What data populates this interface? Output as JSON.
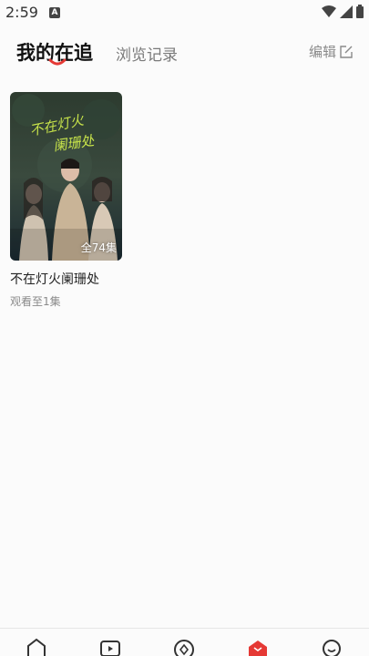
{
  "status_bar": {
    "time": "2:59",
    "notification_icon": "A"
  },
  "tabs": {
    "following_label": "我的在追",
    "history_label": "浏览记录",
    "edit_label": "编辑"
  },
  "cards": [
    {
      "title": "不在灯火阑珊处",
      "progress_label": "观看至1集",
      "episodes_badge": "全74集",
      "poster_text": "不在灯火阑珊处"
    }
  ],
  "colors": {
    "accent": "#e53935",
    "poster_bg_top": "#2d3b2f",
    "poster_bg_bottom": "#1b2a32",
    "poster_text": "#c7e34a"
  },
  "bottom_nav": {
    "items": [
      {
        "icon": "home-icon"
      },
      {
        "icon": "play-icon"
      },
      {
        "icon": "discover-icon"
      },
      {
        "icon": "following-icon",
        "active": true
      },
      {
        "icon": "profile-icon"
      }
    ]
  }
}
